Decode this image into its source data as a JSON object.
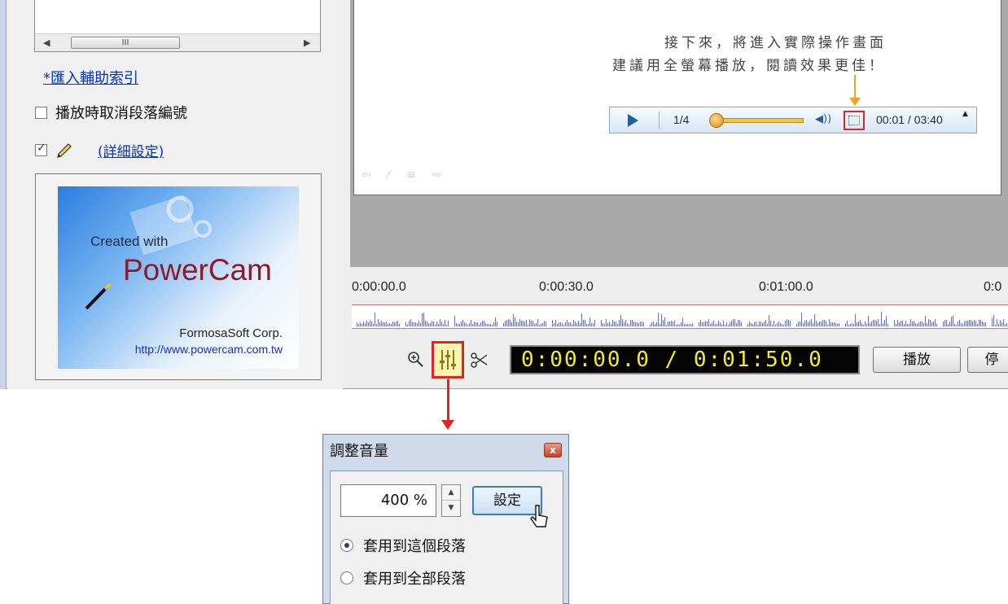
{
  "left_panel": {
    "scroll_thumb": "III",
    "aux_index_link": "*匯入輔助索引",
    "cancel_numbering_label": "播放時取消段落編號",
    "cancel_numbering_checked": false,
    "pen_checked": true,
    "detail_settings_link": "(詳細設定)"
  },
  "logo": {
    "created_with": "Created with",
    "brand": "PowerCam",
    "company": "FormosaSoft Corp.",
    "url": "http://www.powercam.com.tw"
  },
  "preview": {
    "note_line1": "接下來，將進入實際操作畫面",
    "note_line2": "建議用全螢幕播放，閱讀效果更佳！",
    "player": {
      "page": "1/4",
      "time": "00:01 / 03:40"
    }
  },
  "timeline": {
    "ticks": [
      "0:00:00.0",
      "0:00:30.0",
      "0:01:00.0",
      "0:0"
    ],
    "time_display": "0:00:00.0 / 0:01:50.0",
    "play_button": "播放",
    "stop_button": "停"
  },
  "dialog": {
    "title": "調整音量",
    "close": "x",
    "volume_value": "400 %",
    "set_button": "設定",
    "radio_this": "套用到這個段落",
    "radio_all": "套用到全部段落",
    "selected": "this"
  },
  "colors": {
    "highlight_red": "#e12424",
    "arrow_orange": "#f2a21a",
    "lcd_text": "#f4ec2a"
  }
}
